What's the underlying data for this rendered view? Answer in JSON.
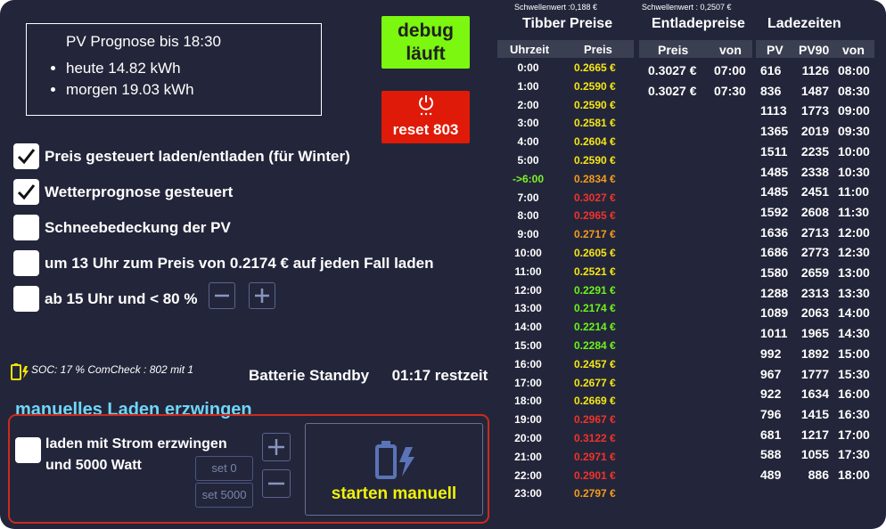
{
  "forecast": {
    "title": "PV Prognose bis 18:30",
    "today": "heute 14.82 kWh",
    "tomorrow": "morgen 19.03 kWh"
  },
  "buttons": {
    "debug_line1": "debug",
    "debug_line2": "läuft",
    "reset": "reset 803"
  },
  "options": [
    {
      "label": "Preis gesteuert laden/entladen (für Winter)",
      "checked": true
    },
    {
      "label": "Wetterprognose gesteuert",
      "checked": true
    },
    {
      "label": "Schneebedeckung der PV",
      "checked": false
    },
    {
      "label": "um 13 Uhr zum Preis von 0.2174 € auf jeden Fall laden",
      "checked": false
    },
    {
      "label": "ab 15 Uhr und < 80 %",
      "checked": false
    }
  ],
  "status": {
    "soc": "SOC: 17 % ComCheck : 802 mit 1",
    "battery_state": "Batterie Standby",
    "remaining": "01:17 restzeit"
  },
  "manual": {
    "title": "manuelles Laden erzwingen",
    "line1": "laden mit Strom erzwingen",
    "line2": "und 5000 Watt",
    "checked": false,
    "set0": "set 0",
    "set5000": "set 5000",
    "start": "starten manuell"
  },
  "tibber": {
    "threshold": "Schwellenwert :0,188 €",
    "title": "Tibber Preise",
    "col_time": "Uhrzeit",
    "col_price": "Preis",
    "rows": [
      {
        "time": "0:00",
        "price": "0.2665 €",
        "color": "#f5e614"
      },
      {
        "time": "1:00",
        "price": "0.2590 €",
        "color": "#f5e614"
      },
      {
        "time": "2:00",
        "price": "0.2590 €",
        "color": "#f5e614"
      },
      {
        "time": "3:00",
        "price": "0.2581 €",
        "color": "#f5e614"
      },
      {
        "time": "4:00",
        "price": "0.2604 €",
        "color": "#f5e614"
      },
      {
        "time": "5:00",
        "price": "0.2590 €",
        "color": "#f5e614"
      },
      {
        "time": "->6:00",
        "price": "0.2834 €",
        "color": "#f59b1a",
        "current": true
      },
      {
        "time": "7:00",
        "price": "0.3027 €",
        "color": "#f0332b"
      },
      {
        "time": "8:00",
        "price": "0.2965 €",
        "color": "#f0332b"
      },
      {
        "time": "9:00",
        "price": "0.2717 €",
        "color": "#f59b1a"
      },
      {
        "time": "10:00",
        "price": "0.2605 €",
        "color": "#f5e614"
      },
      {
        "time": "11:00",
        "price": "0.2521 €",
        "color": "#f5e614"
      },
      {
        "time": "12:00",
        "price": "0.2291 €",
        "color": "#6ef21a"
      },
      {
        "time": "13:00",
        "price": "0.2174 €",
        "color": "#6ef21a"
      },
      {
        "time": "14:00",
        "price": "0.2214 €",
        "color": "#6ef21a"
      },
      {
        "time": "15:00",
        "price": "0.2284 €",
        "color": "#6ef21a"
      },
      {
        "time": "16:00",
        "price": "0.2457 €",
        "color": "#f5e614"
      },
      {
        "time": "17:00",
        "price": "0.2677 €",
        "color": "#f5e614"
      },
      {
        "time": "18:00",
        "price": "0.2669 €",
        "color": "#f5e614"
      },
      {
        "time": "19:00",
        "price": "0.2967 €",
        "color": "#f0332b"
      },
      {
        "time": "20:00",
        "price": "0.3122 €",
        "color": "#f0332b"
      },
      {
        "time": "21:00",
        "price": "0.2971 €",
        "color": "#f0332b"
      },
      {
        "time": "22:00",
        "price": "0.2901 €",
        "color": "#f0332b"
      },
      {
        "time": "23:00",
        "price": "0.2797 €",
        "color": "#f59b1a"
      }
    ]
  },
  "discharge": {
    "threshold": "Schwellenwert : 0,2507 €",
    "title": "Entladepreise",
    "col_price": "Preis",
    "col_from": "von",
    "rows": [
      {
        "price": "0.3027 €",
        "from": "07:00"
      },
      {
        "price": "0.3027 €",
        "from": "07:30"
      }
    ]
  },
  "charge_times": {
    "title": "Ladezeiten",
    "col_pv": "PV",
    "col_pv90": "PV90",
    "col_from": "von",
    "rows": [
      {
        "pv": "616",
        "pv90": "1126",
        "from": "08:00"
      },
      {
        "pv": "836",
        "pv90": "1487",
        "from": "08:30"
      },
      {
        "pv": "1113",
        "pv90": "1773",
        "from": "09:00"
      },
      {
        "pv": "1365",
        "pv90": "2019",
        "from": "09:30"
      },
      {
        "pv": "1511",
        "pv90": "2235",
        "from": "10:00"
      },
      {
        "pv": "1485",
        "pv90": "2338",
        "from": "10:30"
      },
      {
        "pv": "1485",
        "pv90": "2451",
        "from": "11:00"
      },
      {
        "pv": "1592",
        "pv90": "2608",
        "from": "11:30"
      },
      {
        "pv": "1636",
        "pv90": "2713",
        "from": "12:00"
      },
      {
        "pv": "1686",
        "pv90": "2773",
        "from": "12:30"
      },
      {
        "pv": "1580",
        "pv90": "2659",
        "from": "13:00"
      },
      {
        "pv": "1288",
        "pv90": "2313",
        "from": "13:30"
      },
      {
        "pv": "1089",
        "pv90": "2063",
        "from": "14:00"
      },
      {
        "pv": "1011",
        "pv90": "1965",
        "from": "14:30"
      },
      {
        "pv": "992",
        "pv90": "1892",
        "from": "15:00"
      },
      {
        "pv": "967",
        "pv90": "1777",
        "from": "15:30"
      },
      {
        "pv": "922",
        "pv90": "1634",
        "from": "16:00"
      },
      {
        "pv": "796",
        "pv90": "1415",
        "from": "16:30"
      },
      {
        "pv": "681",
        "pv90": "1217",
        "from": "17:00"
      },
      {
        "pv": "588",
        "pv90": "1055",
        "from": "17:30"
      },
      {
        "pv": "489",
        "pv90": "886",
        "from": "18:00"
      }
    ]
  },
  "colors": {
    "background": "#23263a",
    "debug": "#7cf70f",
    "reset": "#e01a08",
    "manual_title": "#6fd6f7",
    "start_text": "#f0f20a",
    "current_hour": "#7ef22a"
  }
}
